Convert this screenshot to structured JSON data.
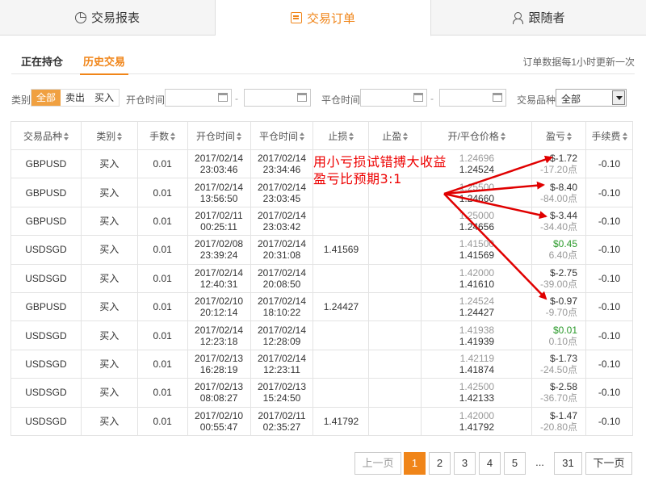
{
  "tabs": [
    {
      "label": "交易报表",
      "icon": "chart-icon"
    },
    {
      "label": "交易订单",
      "icon": "order-icon"
    },
    {
      "label": "跟随者",
      "icon": "user-icon"
    }
  ],
  "subtabs": {
    "positions": "正在持仓",
    "history": "历史交易",
    "note": "订单数据每1小时更新一次"
  },
  "filters": {
    "type_label": "类别",
    "type_options": [
      "全部",
      "卖出",
      "买入"
    ],
    "open_time_label": "开仓时间",
    "close_time_label": "平仓时间",
    "range_sep": "-",
    "symbol_label": "交易品种",
    "symbol_value": "全部"
  },
  "table": {
    "headers": [
      "交易品种",
      "类别",
      "手数",
      "开仓时间",
      "平仓时间",
      "止损",
      "止盈",
      "开/平仓价格",
      "盈亏",
      "手续费"
    ],
    "rows": [
      {
        "symbol": "GBPUSD",
        "type": "买入",
        "lots": "0.01",
        "open_date": "2017/02/14",
        "open_time": "23:03:46",
        "close_date": "2017/02/14",
        "close_time": "23:34:46",
        "sl": "",
        "tp": "",
        "open_price": "1.24696",
        "close_price": "1.24524",
        "pl": "$-1.72",
        "points": "-17.20点",
        "fee": "-0.10"
      },
      {
        "symbol": "GBPUSD",
        "type": "买入",
        "lots": "0.01",
        "open_date": "2017/02/14",
        "open_time": "13:56:50",
        "close_date": "2017/02/14",
        "close_time": "23:03:45",
        "sl": "",
        "tp": "",
        "open_price": "1.25500",
        "close_price": "1.24660",
        "pl": "$-8.40",
        "points": "-84.00点",
        "fee": "-0.10"
      },
      {
        "symbol": "GBPUSD",
        "type": "买入",
        "lots": "0.01",
        "open_date": "2017/02/11",
        "open_time": "00:25:11",
        "close_date": "2017/02/14",
        "close_time": "23:03:42",
        "sl": "",
        "tp": "",
        "open_price": "1.25000",
        "close_price": "1.24656",
        "pl": "$-3.44",
        "points": "-34.40点",
        "fee": "-0.10"
      },
      {
        "symbol": "USDSGD",
        "type": "买入",
        "lots": "0.01",
        "open_date": "2017/02/08",
        "open_time": "23:39:24",
        "close_date": "2017/02/14",
        "close_time": "20:31:08",
        "sl": "1.41569",
        "tp": "",
        "open_price": "1.41500",
        "close_price": "1.41569",
        "pl": "$0.45",
        "points": "6.40点",
        "fee": "-0.10"
      },
      {
        "symbol": "USDSGD",
        "type": "买入",
        "lots": "0.01",
        "open_date": "2017/02/14",
        "open_time": "12:40:31",
        "close_date": "2017/02/14",
        "close_time": "20:08:50",
        "sl": "",
        "tp": "",
        "open_price": "1.42000",
        "close_price": "1.41610",
        "pl": "$-2.75",
        "points": "-39.00点",
        "fee": "-0.10"
      },
      {
        "symbol": "GBPUSD",
        "type": "买入",
        "lots": "0.01",
        "open_date": "2017/02/10",
        "open_time": "20:12:14",
        "close_date": "2017/02/14",
        "close_time": "18:10:22",
        "sl": "1.24427",
        "tp": "",
        "open_price": "1.24524",
        "close_price": "1.24427",
        "pl": "$-0.97",
        "points": "-9.70点",
        "fee": "-0.10"
      },
      {
        "symbol": "USDSGD",
        "type": "买入",
        "lots": "0.01",
        "open_date": "2017/02/14",
        "open_time": "12:23:18",
        "close_date": "2017/02/14",
        "close_time": "12:28:09",
        "sl": "",
        "tp": "",
        "open_price": "1.41938",
        "close_price": "1.41939",
        "pl": "$0.01",
        "points": "0.10点",
        "fee": "-0.10"
      },
      {
        "symbol": "USDSGD",
        "type": "买入",
        "lots": "0.01",
        "open_date": "2017/02/13",
        "open_time": "16:28:19",
        "close_date": "2017/02/14",
        "close_time": "12:23:11",
        "sl": "",
        "tp": "",
        "open_price": "1.42119",
        "close_price": "1.41874",
        "pl": "$-1.73",
        "points": "-24.50点",
        "fee": "-0.10"
      },
      {
        "symbol": "USDSGD",
        "type": "买入",
        "lots": "0.01",
        "open_date": "2017/02/13",
        "open_time": "08:08:27",
        "close_date": "2017/02/13",
        "close_time": "15:24:50",
        "sl": "",
        "tp": "",
        "open_price": "1.42500",
        "close_price": "1.42133",
        "pl": "$-2.58",
        "points": "-36.70点",
        "fee": "-0.10"
      },
      {
        "symbol": "USDSGD",
        "type": "买入",
        "lots": "0.01",
        "open_date": "2017/02/10",
        "open_time": "00:55:47",
        "close_date": "2017/02/11",
        "close_time": "02:35:27",
        "sl": "1.41792",
        "tp": "",
        "open_price": "1.42000",
        "close_price": "1.41792",
        "pl": "$-1.47",
        "points": "-20.80点",
        "fee": "-0.10"
      }
    ]
  },
  "pager": {
    "prev": "上一页",
    "pages": [
      "1",
      "2",
      "3",
      "4",
      "5"
    ],
    "ellipsis": "...",
    "last": "31",
    "next": "下一页",
    "current": "1"
  },
  "annotation": {
    "line1": "用小亏损试错搏大收益",
    "line2": "盈亏比预期3:1",
    "color": "#e00000"
  },
  "colors": {
    "accent": "#f08519",
    "buy": "#2a9a2a",
    "annotation": "#e00000"
  }
}
